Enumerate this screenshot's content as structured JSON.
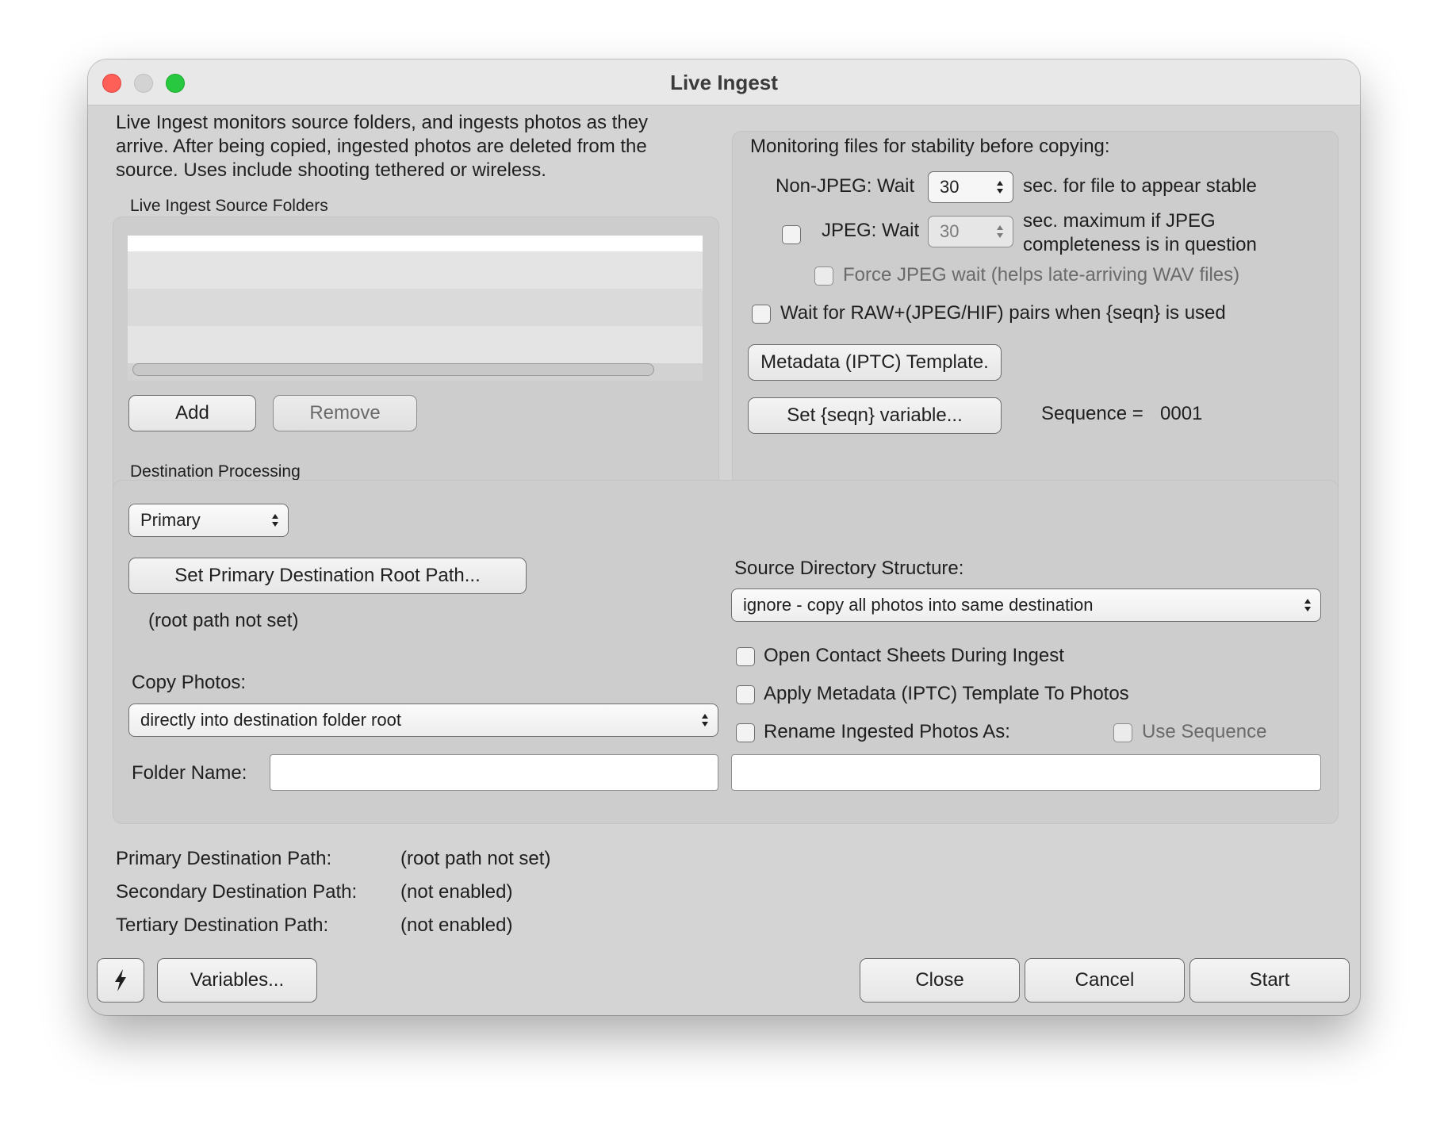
{
  "window": {
    "title": "Live Ingest"
  },
  "intro": {
    "line1": "Live Ingest monitors source folders, and ingests photos as they",
    "line2": "arrive. After being copied, ingested photos are deleted from the",
    "line3": "source. Uses include shooting tethered or wireless."
  },
  "source_folders": {
    "label": "Live Ingest Source Folders",
    "add_label": "Add",
    "remove_label": "Remove"
  },
  "monitoring": {
    "heading": "Monitoring files for stability before copying:",
    "non_jpeg_label": "Non-JPEG: Wait",
    "non_jpeg_value": "30",
    "non_jpeg_suffix": "sec. for file to appear stable",
    "jpeg_label": "JPEG: Wait",
    "jpeg_value": "30",
    "jpeg_suffix_line1": "sec. maximum if JPEG",
    "jpeg_suffix_line2": "completeness is in question",
    "force_jpeg_label": "Force JPEG wait (helps late-arriving WAV files)",
    "wait_pairs_label": "Wait for RAW+(JPEG/HIF) pairs when {seqn} is used",
    "metadata_template_label": "Metadata (IPTC) Template.",
    "set_seqn_label": "Set {seqn} variable...",
    "sequence_label": "Sequence =",
    "sequence_value": "0001"
  },
  "destination": {
    "label": "Destination Processing",
    "destination_select": "Primary",
    "set_root_label": "Set Primary Destination Root Path...",
    "root_status": "(root path not set)",
    "copy_photos_label": "Copy Photos:",
    "copy_photos_select": "directly into destination folder root",
    "folder_name_label": "Folder Name:",
    "folder_name_value": "",
    "source_structure_label": "Source Directory Structure:",
    "source_structure_select": "ignore - copy all photos into same destination",
    "open_contact_sheets_label": "Open Contact Sheets During Ingest",
    "apply_metadata_label": "Apply Metadata (IPTC) Template To Photos",
    "rename_label": "Rename Ingested Photos As:",
    "use_sequence_label": "Use Sequence",
    "rename_value": ""
  },
  "paths": {
    "primary_label": "Primary Destination Path:",
    "primary_value": "(root path not set)",
    "secondary_label": "Secondary Destination Path:",
    "secondary_value": "(not enabled)",
    "tertiary_label": "Tertiary Destination Path:",
    "tertiary_value": "(not enabled)"
  },
  "footer": {
    "variables_label": "Variables...",
    "close_label": "Close",
    "cancel_label": "Cancel",
    "start_label": "Start"
  },
  "colors": {
    "close_light": "#fe5f57",
    "minimize_light": "#d3d3d3",
    "zoom_light": "#28c840",
    "window_bg": "#d4d4d4"
  },
  "icons": {
    "lightning": "lightning-icon",
    "stepper": "stepper-arrows-icon",
    "popup": "popup-arrows-icon"
  }
}
